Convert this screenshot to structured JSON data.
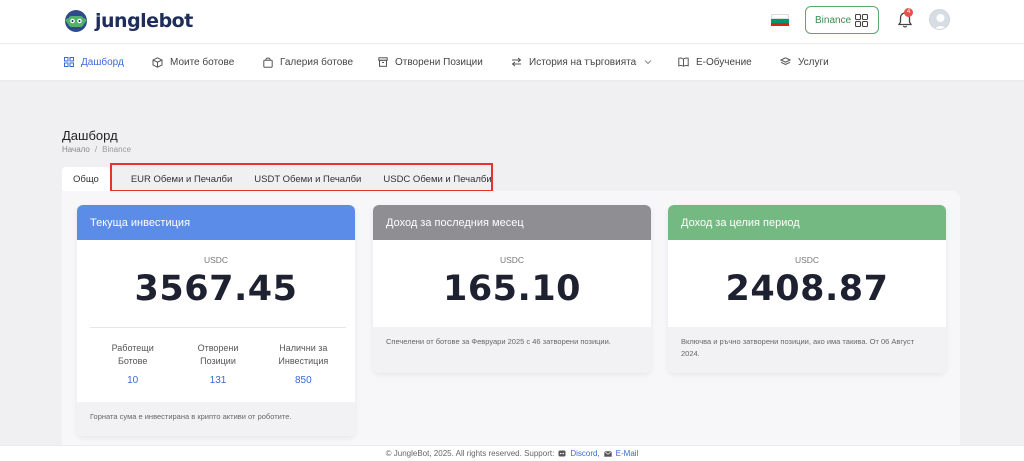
{
  "brand": {
    "name": "junglebot"
  },
  "header": {
    "exchange_label": "Binance",
    "notification_count": "4",
    "flag_colors": [
      "#ffffff",
      "#00966e",
      "#d62612"
    ]
  },
  "nav": {
    "items": [
      {
        "label": "Дашборд",
        "icon": "dashboard-grid-icon"
      },
      {
        "label": "Моите ботове",
        "icon": "cube-icon"
      },
      {
        "label": "Галерия ботове",
        "icon": "bag-icon"
      },
      {
        "label": "Отворени Позиции",
        "icon": "box-icon"
      },
      {
        "label": "История на търговията",
        "icon": "exchange-arrows-icon"
      },
      {
        "label": "Е-Обучение",
        "icon": "book-icon"
      },
      {
        "label": "Услуги",
        "icon": "layers-icon"
      }
    ]
  },
  "page": {
    "title": "Дашборд",
    "breadcrumb": [
      "Начало",
      "/",
      "Binance"
    ]
  },
  "tabs": [
    "Общо",
    "EUR Обеми и Печалби",
    "USDT Обеми и Печалби",
    "USDC Обеми и Печалби"
  ],
  "cards": {
    "investment": {
      "title": "Текуща инвестиция",
      "currency": "USDC",
      "value": "3567.45",
      "color": "#5a8ce8",
      "stats": [
        {
          "label1": "Работещи",
          "label2": "Ботове",
          "value": "10"
        },
        {
          "label1": "Отворени",
          "label2": "Позиции",
          "value": "131"
        },
        {
          "label1": "Налични за",
          "label2": "Инвестиция",
          "value": "850"
        }
      ],
      "note": "Горната сума е инвестирана в крипто активи от роботите."
    },
    "last_month": {
      "title": "Доход за последния месец",
      "currency": "USDC",
      "value": "165.10",
      "color": "#8e8e93",
      "note": "Спечелени от ботове за Февруари 2025 с 46 затворени позиции."
    },
    "all_time": {
      "title": "Доход за целия период",
      "currency": "USDC",
      "value": "2408.87",
      "color": "#74b981",
      "note": "Включва и ръчно затворени позиции, ако има такива. От 06 Август 2024."
    }
  },
  "footer": {
    "text": "© JungleBot, 2025. All rights reserved. Support:",
    "discord": "Discord,",
    "email": "E-Mail"
  }
}
